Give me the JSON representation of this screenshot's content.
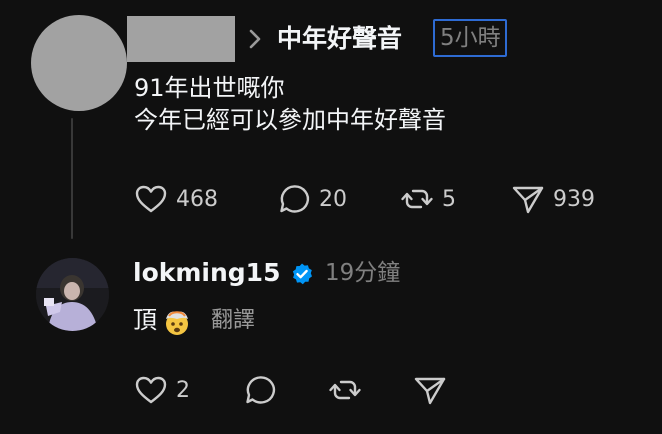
{
  "post": {
    "group_name": "中年好聲音",
    "timestamp": "5小時",
    "text_lines": [
      "91年出世嘅你",
      "今年已經可以參加中年好聲音"
    ],
    "likes": "468",
    "comments": "20",
    "reposts": "5",
    "shares": "939",
    "username_redacted": true
  },
  "reply": {
    "username": "lokming15",
    "verified": true,
    "timestamp": "19分鐘",
    "text": "頂",
    "emoji": "face-with-exploding-head",
    "translate_label": "翻譯",
    "likes": "2"
  },
  "colors": {
    "background": "#101010",
    "text": "#f3f5f7",
    "muted": "#808080",
    "icon": "#cccccc",
    "verified_badge": "#0095f6",
    "focus_outline": "#2e6bd3",
    "redaction": "#a2a2a2"
  },
  "icons": [
    "heart-icon",
    "comment-icon",
    "repost-icon",
    "share-icon",
    "chevron-right-icon",
    "verified-badge-icon"
  ]
}
